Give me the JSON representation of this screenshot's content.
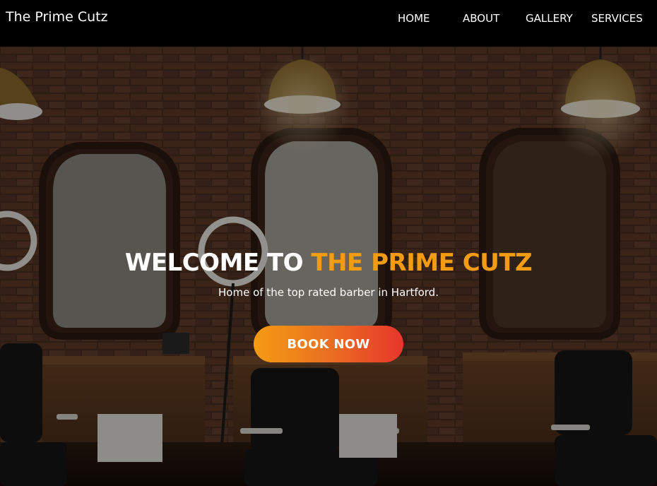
{
  "navbar": {
    "brand": "The Prime Cutz",
    "links": [
      "HOME",
      "ABOUT",
      "GALLERY",
      "SERVICES"
    ]
  },
  "hero": {
    "title_prefix": "WELCOME TO ",
    "title_accent": "THE PRIME CUTZ",
    "subtitle": "Home of the top rated barber in Hartford.",
    "button_label": "BOOK NOW"
  },
  "colors": {
    "accent": "#f39c12",
    "button_gradient_start": "#f39c12",
    "button_gradient_end": "#e8352c",
    "navbar_bg": "#000000"
  }
}
